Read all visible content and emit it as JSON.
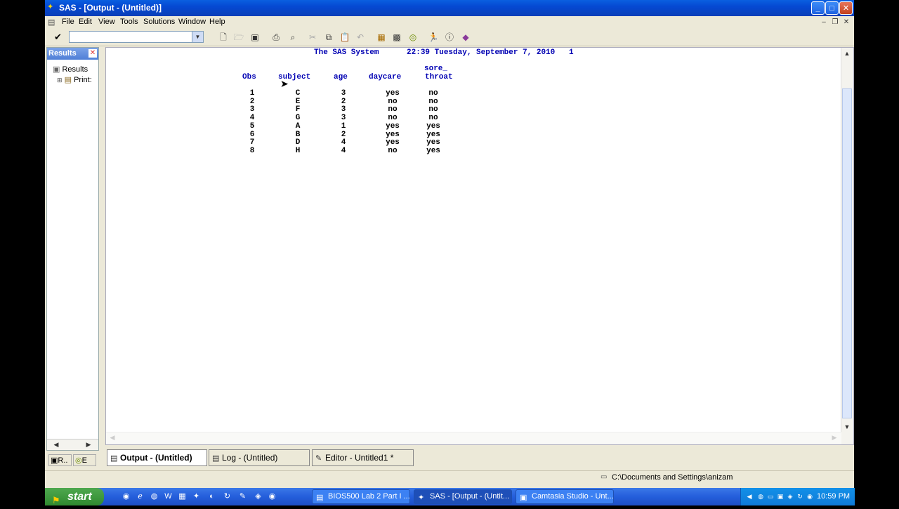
{
  "window": {
    "title": "SAS - [Output - (Untitled)]",
    "controls": {
      "minimize": "_",
      "maximize": "□",
      "close": "✕"
    }
  },
  "menu": [
    "File",
    "Edit",
    "View",
    "Tools",
    "Solutions",
    "Window",
    "Help"
  ],
  "command_box": {
    "value": ""
  },
  "results_pane": {
    "title": "Results",
    "tree": [
      {
        "label": "Results"
      },
      {
        "label": "Print:"
      }
    ],
    "tabs": [
      "R..",
      "E"
    ]
  },
  "output": {
    "header_line": "The SAS System      22:39 Tuesday, September 7, 2010   1",
    "columns": [
      "Obs",
      "subject",
      "age",
      "daycare",
      "sore_",
      "throat"
    ],
    "rows": [
      [
        "1",
        "C",
        "3",
        "yes",
        "no"
      ],
      [
        "2",
        "E",
        "2",
        "no",
        "no"
      ],
      [
        "3",
        "F",
        "3",
        "no",
        "no"
      ],
      [
        "4",
        "G",
        "3",
        "no",
        "no"
      ],
      [
        "5",
        "A",
        "1",
        "yes",
        "yes"
      ],
      [
        "6",
        "B",
        "2",
        "yes",
        "yes"
      ],
      [
        "7",
        "D",
        "4",
        "yes",
        "yes"
      ],
      [
        "8",
        "H",
        "4",
        "no",
        "yes"
      ]
    ]
  },
  "window_tabs": [
    "Output - (Untitled)",
    "Log - (Untitled)",
    "Editor - Untitled1 *"
  ],
  "status": {
    "path": "C:\\Documents and Settings\\anizam"
  },
  "taskbar": {
    "start": "start",
    "tasks": [
      "BIOS500 Lab 2 Part I ...",
      "SAS - [Output - (Untit...",
      "Camtasia Studio - Unt..."
    ],
    "clock": "10:59 PM"
  }
}
